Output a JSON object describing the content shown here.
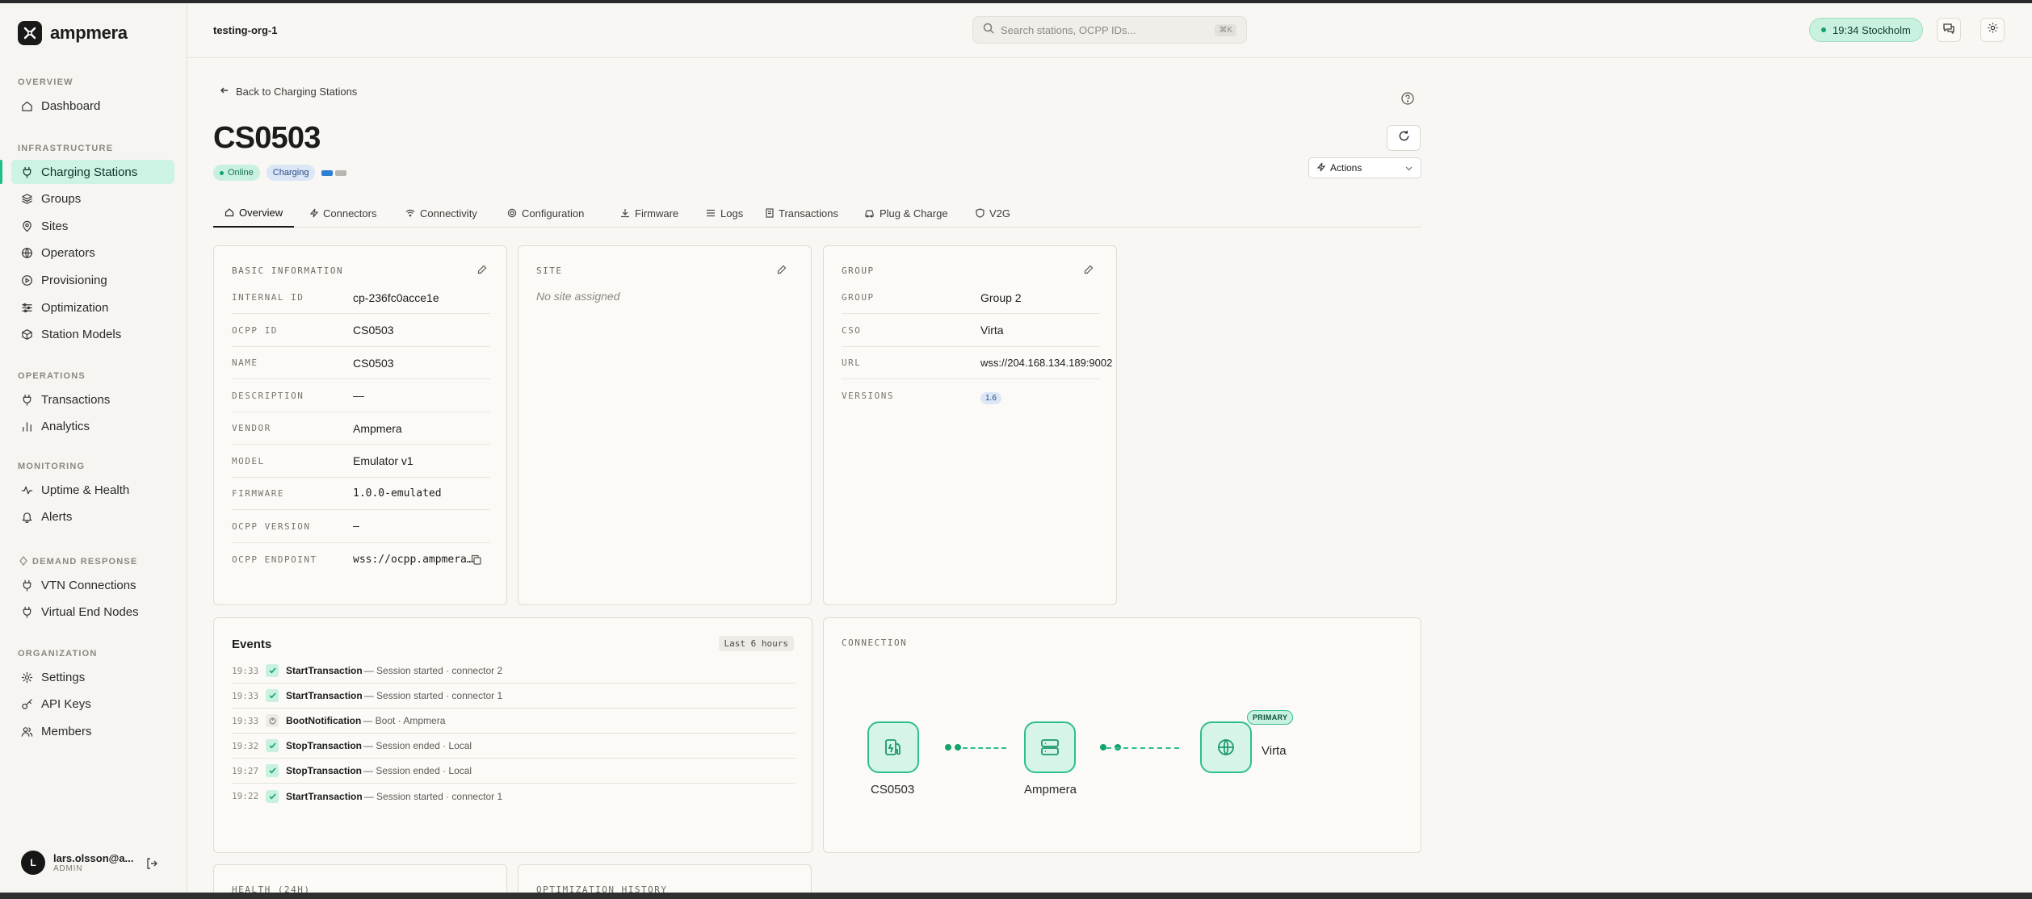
{
  "app": {
    "brand": "ampmera",
    "org": "testing-org-1"
  },
  "search": {
    "placeholder": "Search stations, OCPP IDs...",
    "shortcut": "⌘K"
  },
  "header": {
    "clock": "19:34 Stockholm"
  },
  "sidebar": {
    "sections": [
      {
        "label": "OVERVIEW",
        "items": [
          {
            "label": "Dashboard",
            "icon": "home-icon"
          }
        ]
      },
      {
        "label": "INFRASTRUCTURE",
        "items": [
          {
            "label": "Charging Stations",
            "icon": "plug-icon",
            "active": true
          },
          {
            "label": "Groups",
            "icon": "layers-icon"
          },
          {
            "label": "Sites",
            "icon": "map-pin-icon"
          },
          {
            "label": "Operators",
            "icon": "globe-icon"
          },
          {
            "label": "Provisioning",
            "icon": "play-circle-icon"
          },
          {
            "label": "Optimization",
            "icon": "sliders-icon"
          },
          {
            "label": "Station Models",
            "icon": "box-icon"
          }
        ]
      },
      {
        "label": "OPERATIONS",
        "items": [
          {
            "label": "Transactions",
            "icon": "plug-icon"
          },
          {
            "label": "Analytics",
            "icon": "bar-chart-icon"
          }
        ]
      },
      {
        "label": "MONITORING",
        "items": [
          {
            "label": "Uptime & Health",
            "icon": "activity-icon"
          },
          {
            "label": "Alerts",
            "icon": "bell-icon"
          }
        ]
      },
      {
        "label": "DEMAND RESPONSE",
        "items": [
          {
            "label": "VTN Connections",
            "icon": "plug-icon"
          },
          {
            "label": "Virtual End Nodes",
            "icon": "plug-icon"
          }
        ]
      },
      {
        "label": "ORGANIZATION",
        "items": [
          {
            "label": "Settings",
            "icon": "gear-icon"
          },
          {
            "label": "API Keys",
            "icon": "key-icon"
          },
          {
            "label": "Members",
            "icon": "users-icon"
          }
        ]
      }
    ],
    "user": {
      "initial": "L",
      "name": "lars.olsson@a...",
      "role": "ADMIN"
    }
  },
  "page": {
    "back_label": "Back to Charging Stations",
    "title": "CS0503",
    "status_badges": [
      "Online",
      "Charging"
    ],
    "actions_label": "Actions",
    "tabs": [
      "Overview",
      "Connectors",
      "Connectivity",
      "Configuration",
      "Firmware",
      "Logs",
      "Transactions",
      "Plug & Charge",
      "V2G"
    ]
  },
  "basic_info": {
    "label": "BASIC INFORMATION",
    "rows": [
      {
        "key": "INTERNAL ID",
        "value": "cp-236fc0acce1e"
      },
      {
        "key": "OCPP ID",
        "value": "CS0503"
      },
      {
        "key": "NAME",
        "value": "CS0503"
      },
      {
        "key": "DESCRIPTION",
        "value": "—"
      },
      {
        "key": "VENDOR",
        "value": "Ampmera"
      },
      {
        "key": "MODEL",
        "value": "Emulator v1"
      },
      {
        "key": "FIRMWARE",
        "value": "1.0.0-emulated"
      },
      {
        "key": "OCPP VERSION",
        "value": "—"
      },
      {
        "key": "OCPP ENDPOINT",
        "value": "wss://ocpp.ampmera…"
      }
    ]
  },
  "site": {
    "label": "SITE",
    "empty": "No site assigned"
  },
  "group": {
    "label": "GROUP",
    "rows": [
      {
        "key": "GROUP",
        "value": "Group 2"
      },
      {
        "key": "CSO",
        "value": "Virta"
      },
      {
        "key": "URL",
        "value": "wss://204.168.134.189:9002"
      },
      {
        "key": "VERSIONS",
        "value": "1.6"
      }
    ]
  },
  "events": {
    "title": "Events",
    "range": "Last 6 hours",
    "items": [
      {
        "time": "19:33",
        "name": "StartTransaction",
        "desc": "— Session started · connector 2",
        "status": "ok"
      },
      {
        "time": "19:33",
        "name": "StartTransaction",
        "desc": "— Session started · connector 1",
        "status": "ok"
      },
      {
        "time": "19:33",
        "name": "BootNotification",
        "desc": "— Boot · Ampmera",
        "status": "info"
      },
      {
        "time": "19:32",
        "name": "StopTransaction",
        "desc": "— Session ended · Local",
        "status": "ok"
      },
      {
        "time": "19:27",
        "name": "StopTransaction",
        "desc": "— Session ended · Local",
        "status": "ok"
      },
      {
        "time": "19:22",
        "name": "StartTransaction",
        "desc": "— Session started · connector 1",
        "status": "ok"
      }
    ]
  },
  "connection": {
    "label": "CONNECTION",
    "nodes": [
      {
        "label": "CS0503",
        "icon": "fuel-pump-icon"
      },
      {
        "label": "Ampmera",
        "icon": "server-icon"
      },
      {
        "label": "Virta",
        "icon": "globe-icon",
        "tag": "PRIMARY"
      }
    ]
  },
  "lower_cards": [
    "HEALTH (24H)",
    "OPTIMIZATION HISTORY"
  ],
  "colors": {
    "accent": "#1fbf88",
    "online_bg": "#c9f1df",
    "charging_bg": "#dbe6f6"
  }
}
